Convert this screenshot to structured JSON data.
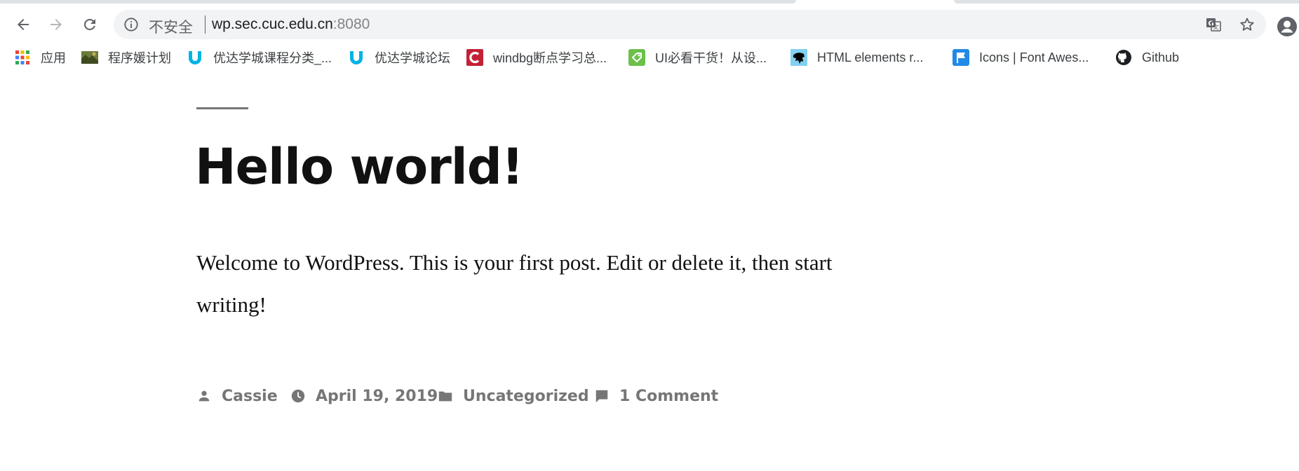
{
  "browser": {
    "omnibox": {
      "security_text": "不安全",
      "url_host": "wp.sec.cuc.edu.cn",
      "url_port": ":8080"
    },
    "bookmarks": [
      {
        "label": "应用",
        "icon": "apps-grid-icon"
      },
      {
        "label": "程序媛计划",
        "icon": "landscape-favicon"
      },
      {
        "label": "优达学城课程分类_...",
        "icon": "udacity-icon"
      },
      {
        "label": "优达学城论坛",
        "icon": "udacity-icon"
      },
      {
        "label": "windbg断点学习总...",
        "icon": "csdn-icon"
      },
      {
        "label": "UI必看干货！从设...",
        "icon": "tag-icon"
      },
      {
        "label": "HTML elements r...",
        "icon": "mdn-dino-icon"
      },
      {
        "label": "Icons | Font Awes...",
        "icon": "flag-icon"
      },
      {
        "label": "Github",
        "icon": "github-icon"
      }
    ]
  },
  "post": {
    "title": "Hello world!",
    "body": "Welcome to WordPress. This is your first post. Edit or delete it, then start writing!",
    "meta": {
      "author": "Cassie",
      "date": "April 19, 2019",
      "category": "Uncategorized",
      "comments": "1 Comment"
    }
  },
  "colors": {
    "text": "#111111",
    "meta": "#767676",
    "omnibox_bg": "#f1f3f4"
  }
}
